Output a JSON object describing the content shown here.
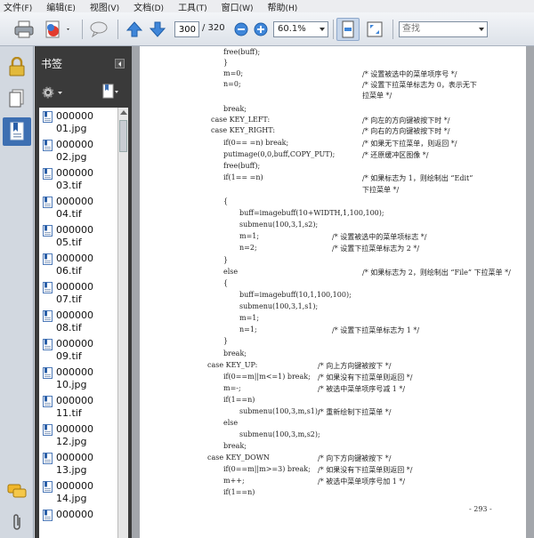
{
  "menu": [
    {
      "label": "文件",
      "hotkey": "(F)"
    },
    {
      "label": "编辑",
      "hotkey": "(E)"
    },
    {
      "label": "视图",
      "hotkey": "(V)"
    },
    {
      "label": "文档",
      "hotkey": "(D)"
    },
    {
      "label": "工具",
      "hotkey": "(T)"
    },
    {
      "label": "窗口",
      "hotkey": "(W)"
    },
    {
      "label": "帮助",
      "hotkey": "(H)"
    }
  ],
  "toolbar": {
    "page_current": "300",
    "page_total": "/ 320",
    "zoom": "60.1%",
    "find_placeholder": "查找"
  },
  "icons": [
    "print-icon",
    "create-pdf-icon",
    "comment-bubble-icon",
    "prev-page-icon",
    "next-page-icon",
    "zoom-out-icon",
    "zoom-in-icon",
    "fit-page-icon",
    "full-screen-icon",
    "lock-icon",
    "pages-icon",
    "bookmark-icon",
    "comments-icon",
    "attachment-icon",
    "options-gear-icon",
    "new-bookmark-icon"
  ],
  "bookmarks": {
    "title": "书签",
    "items": [
      {
        "line1": "000000",
        "line2": "01.jpg"
      },
      {
        "line1": "000000",
        "line2": "02.jpg"
      },
      {
        "line1": "000000",
        "line2": "03.tif"
      },
      {
        "line1": "000000",
        "line2": "04.tif"
      },
      {
        "line1": "000000",
        "line2": "05.tif"
      },
      {
        "line1": "000000",
        "line2": "06.tif"
      },
      {
        "line1": "000000",
        "line2": "07.tif"
      },
      {
        "line1": "000000",
        "line2": "08.tif"
      },
      {
        "line1": "000000",
        "line2": "09.tif"
      },
      {
        "line1": "000000",
        "line2": "10.jpg"
      },
      {
        "line1": "000000",
        "line2": "11.tif"
      },
      {
        "line1": "000000",
        "line2": "12.jpg"
      },
      {
        "line1": "000000",
        "line2": "13.jpg"
      },
      {
        "line1": "000000",
        "line2": "14.jpg"
      },
      {
        "line1": "000000",
        "line2": ""
      }
    ]
  },
  "document": {
    "lines": [
      {
        "code": "free(buff);",
        "comment": ""
      },
      {
        "code": "}",
        "comment": ""
      },
      {
        "code": "m=0;",
        "comment": "/* 设置被选中的菜单项序号 */"
      },
      {
        "code": "n=0;",
        "comment": "/* 设置下拉菜单标志为 0，表示无下"
      },
      {
        "code": "",
        "comment": "拉菜单 */"
      },
      {
        "code": "break;",
        "comment": ""
      },
      {
        "code": "case KEY_LEFT:",
        "comment": "/* 向左的方向键被按下时 */"
      },
      {
        "code": "case KEY_RIGHT:",
        "comment": "/* 向右的方向键被按下时 */"
      },
      {
        "code": "if(0== =n) break;",
        "comment": "/* 如果无下拉菜单，则返回 */"
      },
      {
        "code": "putimage(0,0,buff,COPY_PUT);",
        "comment": "/* 还原缓冲区图像 */"
      },
      {
        "code": "free(buff);",
        "comment": ""
      },
      {
        "code": "if(1== =n)",
        "comment": "/* 如果标志为 1，则绘制出 “Edit”"
      },
      {
        "code": "",
        "comment": "下拉菜单 */"
      },
      {
        "code": "{",
        "comment": ""
      },
      {
        "code": "buff=imagebuff(10+WIDTH,1,100,100);",
        "comment": ""
      },
      {
        "code": "submenu(100,3,1,s2);",
        "comment": ""
      },
      {
        "code": "m=1;",
        "comment": "/* 设置被选中的菜单项标志 */"
      },
      {
        "code": "n=2;",
        "comment": "/* 设置下拉菜单标志为 2 */"
      },
      {
        "code": "}",
        "comment": ""
      },
      {
        "code": "else",
        "comment": "/* 如果标志为 2，则绘制出 “File” 下拉菜单 */"
      },
      {
        "code": "{",
        "comment": ""
      },
      {
        "code": "buff=imagebuff(10,1,100,100);",
        "comment": ""
      },
      {
        "code": "submenu(100,3,1,s1);",
        "comment": ""
      },
      {
        "code": "m=1;",
        "comment": ""
      },
      {
        "code": "n=1;",
        "comment": "/* 设置下拉菜单标志为 1 */"
      },
      {
        "code": "}",
        "comment": ""
      },
      {
        "code": "break;",
        "comment": ""
      },
      {
        "code": "case KEY_UP:",
        "comment": "/* 向上方向键被按下 */"
      },
      {
        "code": "if(0==m||m<=1) break;",
        "comment": "/* 如果没有下拉菜单则返回 */"
      },
      {
        "code": "m=-;",
        "comment": "/* 被选中菜单项序号减 1 */"
      },
      {
        "code": "if(1==n)",
        "comment": ""
      },
      {
        "code": "submenu(100,3,m,s1);",
        "comment": "/* 重新绘制下拉菜单 */"
      },
      {
        "code": "else",
        "comment": ""
      },
      {
        "code": "submenu(100,3,m,s2);",
        "comment": ""
      },
      {
        "code": "break;",
        "comment": ""
      },
      {
        "code": "case KEY_DOWN",
        "comment": "/* 向下方向键被按下 */"
      },
      {
        "code": "if(0==m||m>=3) break;",
        "comment": "/* 如果没有下拉菜单则返回 */"
      },
      {
        "code": "m++;",
        "comment": "/* 被选中菜单项序号加 1 */"
      },
      {
        "code": "if(1==n)",
        "comment": ""
      }
    ],
    "page_number": "- 293 -"
  }
}
